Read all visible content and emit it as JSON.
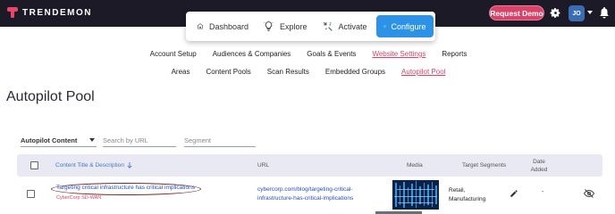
{
  "topbar": {
    "brand": "TRENDEMON",
    "request_demo": "Request Demo",
    "avatar_initials": "JO",
    "colors": {
      "bar": "#1b1a26",
      "brand_accent": "#e8476b",
      "demo_button": "#d8436a",
      "avatar": "#3a6db3"
    }
  },
  "modules": [
    {
      "label": "Dashboard",
      "icon": "house-icon",
      "active": false
    },
    {
      "label": "Explore",
      "icon": "lightbulb-icon",
      "active": false
    },
    {
      "label": "Activate",
      "icon": "sparkle-icon",
      "active": false
    },
    {
      "label": "Configure",
      "icon": "gear-icon",
      "active": true
    }
  ],
  "nav": {
    "row1": [
      "Account Setup",
      "Audiences & Companies",
      "Goals & Events",
      "Website Settings",
      "Reports"
    ],
    "row2": [
      "Areas",
      "Content Pools",
      "Scan Results",
      "Embedded Groups",
      "Autopilot Pool"
    ],
    "active_row1": "Website Settings",
    "active_row2": "Autopilot Pool"
  },
  "page": {
    "title": "Autopilot Pool"
  },
  "filters": {
    "content_type": "Autopilot Content",
    "search_placeholder": "Search by URL",
    "segment_placeholder": "Segment"
  },
  "table": {
    "headers": {
      "title": "Content Title & Description",
      "url": "URL",
      "media": "Media",
      "segments": "Target Segments",
      "date": "Date Added"
    },
    "rows": [
      {
        "title": "Targeting critical infrastructure has critical implications",
        "subtitle": "CyberCorp SD-WAN",
        "url_line1": "cybercorp.com/blog/targeting-critical-",
        "url_line2": "infrastructure-has-critical-implications",
        "segment_line1": "Retail,",
        "segment_line2": "Manufacturing",
        "date": "-"
      }
    ]
  },
  "colors": {
    "accent": "#2b92e8",
    "pink": "#d8436a",
    "link": "#2451b5"
  }
}
